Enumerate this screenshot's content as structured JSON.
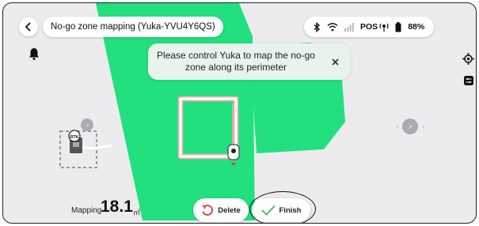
{
  "header": {
    "back_icon": "chevron-left-icon",
    "title": "No-go zone mapping  (Yuka-YVU4Y6QS)"
  },
  "status_bar": {
    "icons": [
      "bluetooth-icon",
      "wifi-icon",
      "cellular-signal-icon",
      "pos-signal-icon",
      "battery-icon"
    ],
    "pos_label": "POS",
    "battery": "88%"
  },
  "toast": {
    "message": "Please control Yuka to map the no-go zone along its perimeter",
    "close_icon": "close-icon"
  },
  "side_controls": {
    "left": [
      "bell-icon"
    ],
    "right": [
      "locate-icon",
      "settings-icon"
    ]
  },
  "map": {
    "lawn_color": "#22e07e",
    "zone_border_color": "#e8a8a8",
    "station_label": "RTK"
  },
  "mapping": {
    "label": "Mapping",
    "value": "18.1",
    "unit": "㎡"
  },
  "actions": {
    "delete_label": "Delete",
    "finish_label": "Finish"
  },
  "colors": {
    "accent_green": "#22e07e",
    "delete_red": "#e53935",
    "finish_green": "#3dbb5c"
  }
}
